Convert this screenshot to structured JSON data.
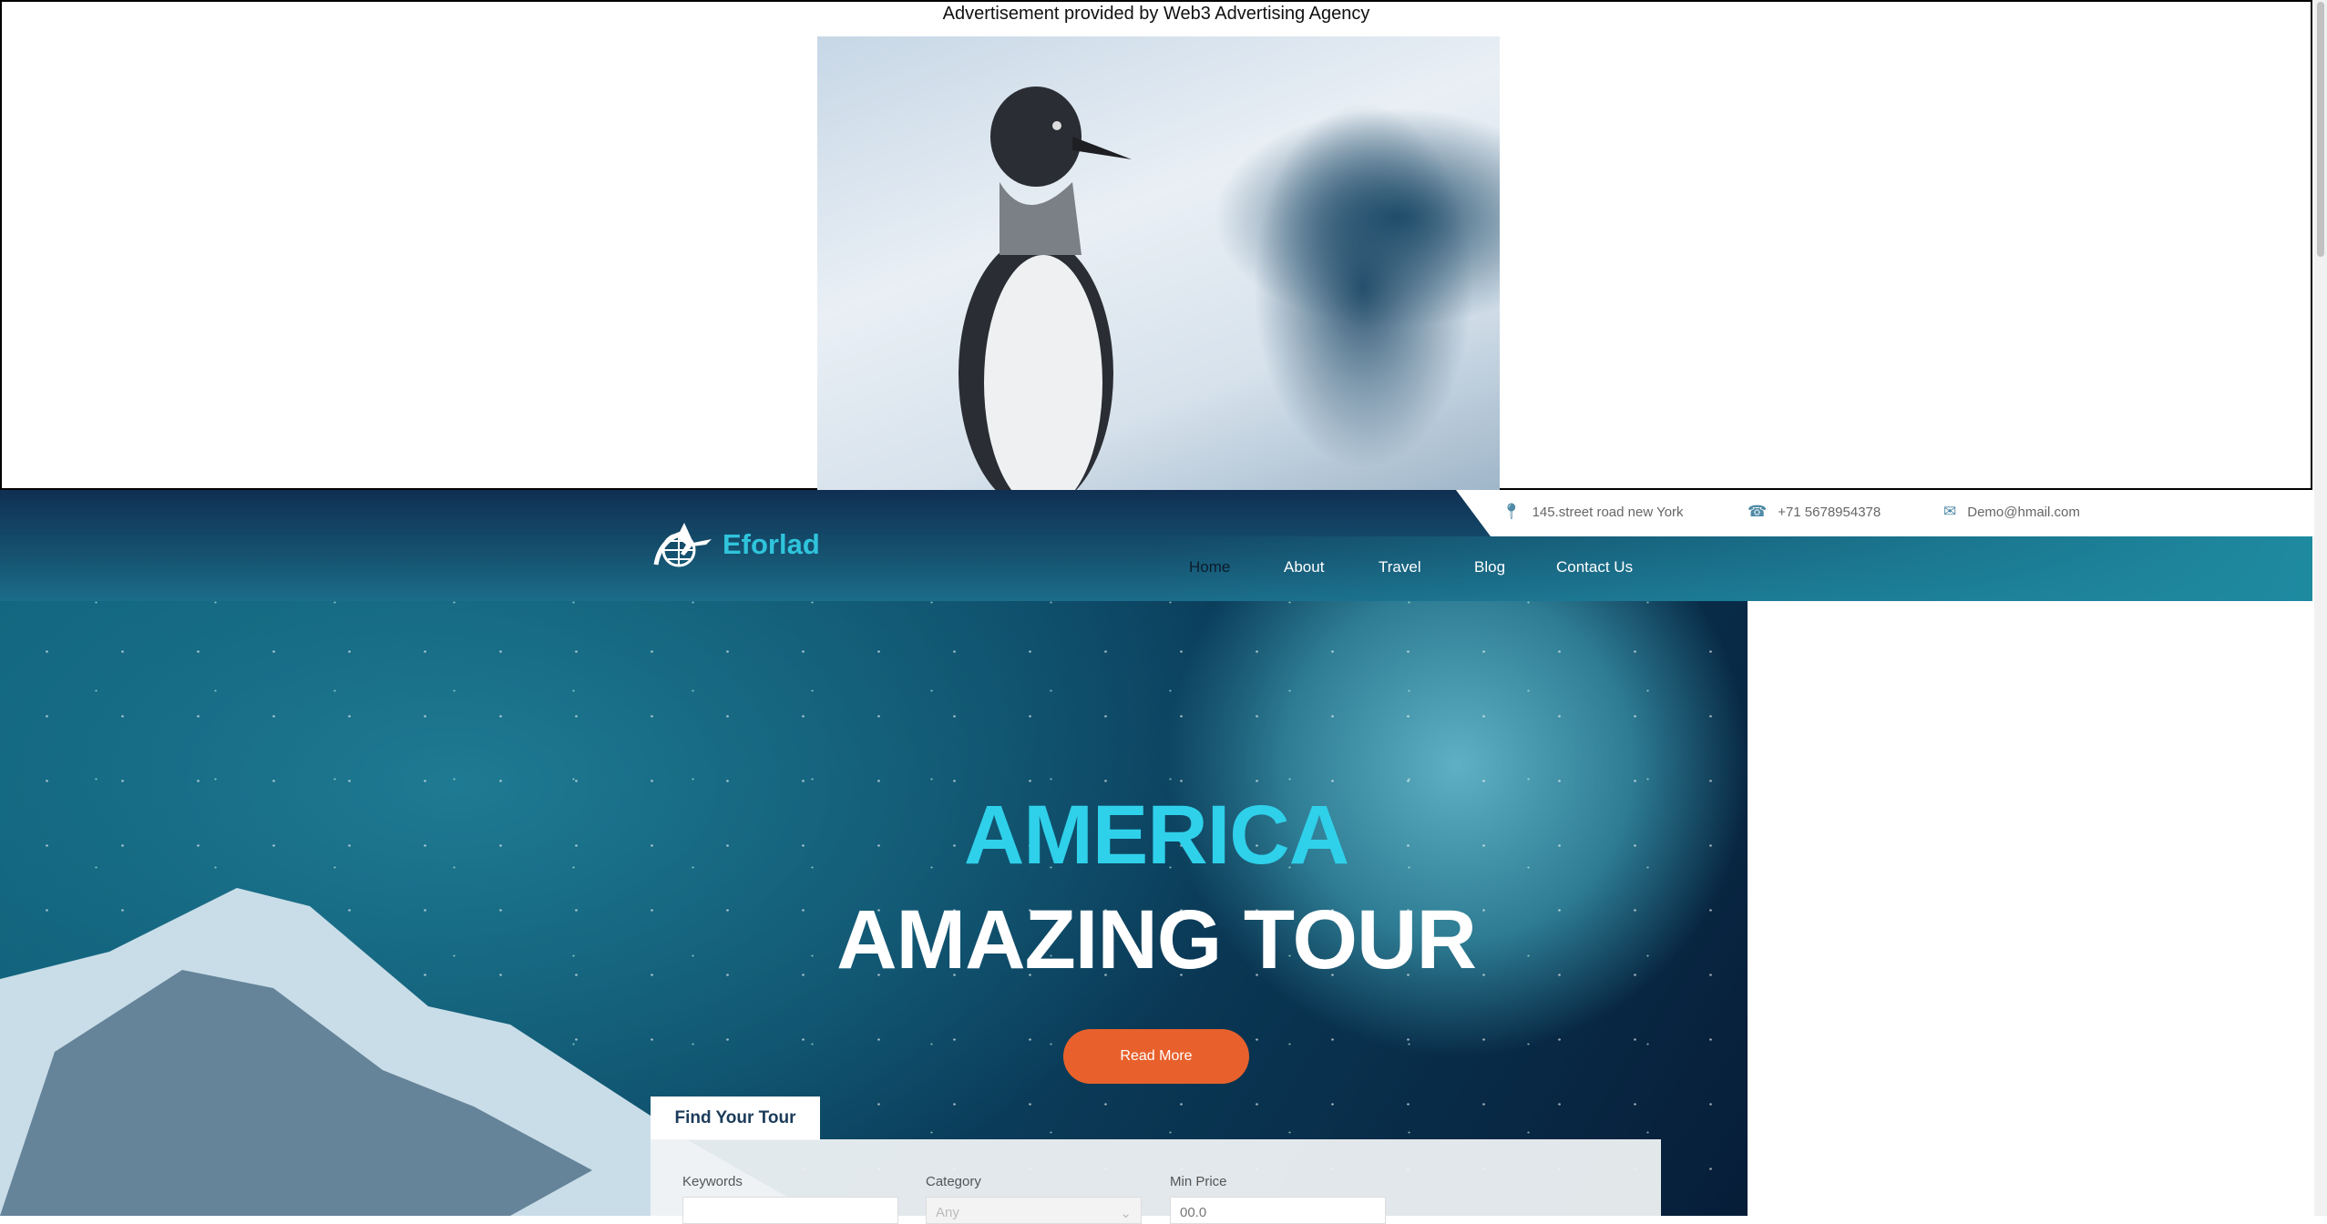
{
  "ad": {
    "caption": "Advertisement provided by Web3 Advertising Agency"
  },
  "topbar": {
    "address": "145.street road new York",
    "phone": "+71 5678954378",
    "email": "Demo@hmail.com"
  },
  "brand": {
    "name": "Eforlad"
  },
  "nav": [
    {
      "label": "Home"
    },
    {
      "label": "About"
    },
    {
      "label": "Travel"
    },
    {
      "label": "Blog"
    },
    {
      "label": "Contact Us"
    }
  ],
  "hero": {
    "line1": "AMERICA",
    "line2": "AMAZING TOUR",
    "cta": "Read More"
  },
  "search": {
    "tab": "Find Your Tour",
    "keywords_label": "Keywords",
    "keywords_value": "",
    "category_label": "Category",
    "category_value": "Any",
    "min_price_label": "Min Price",
    "min_price_value": "00.0"
  },
  "colors": {
    "accent": "#2fc4dc",
    "cta": "#e8612c",
    "navbar": "#1e8aa0"
  }
}
